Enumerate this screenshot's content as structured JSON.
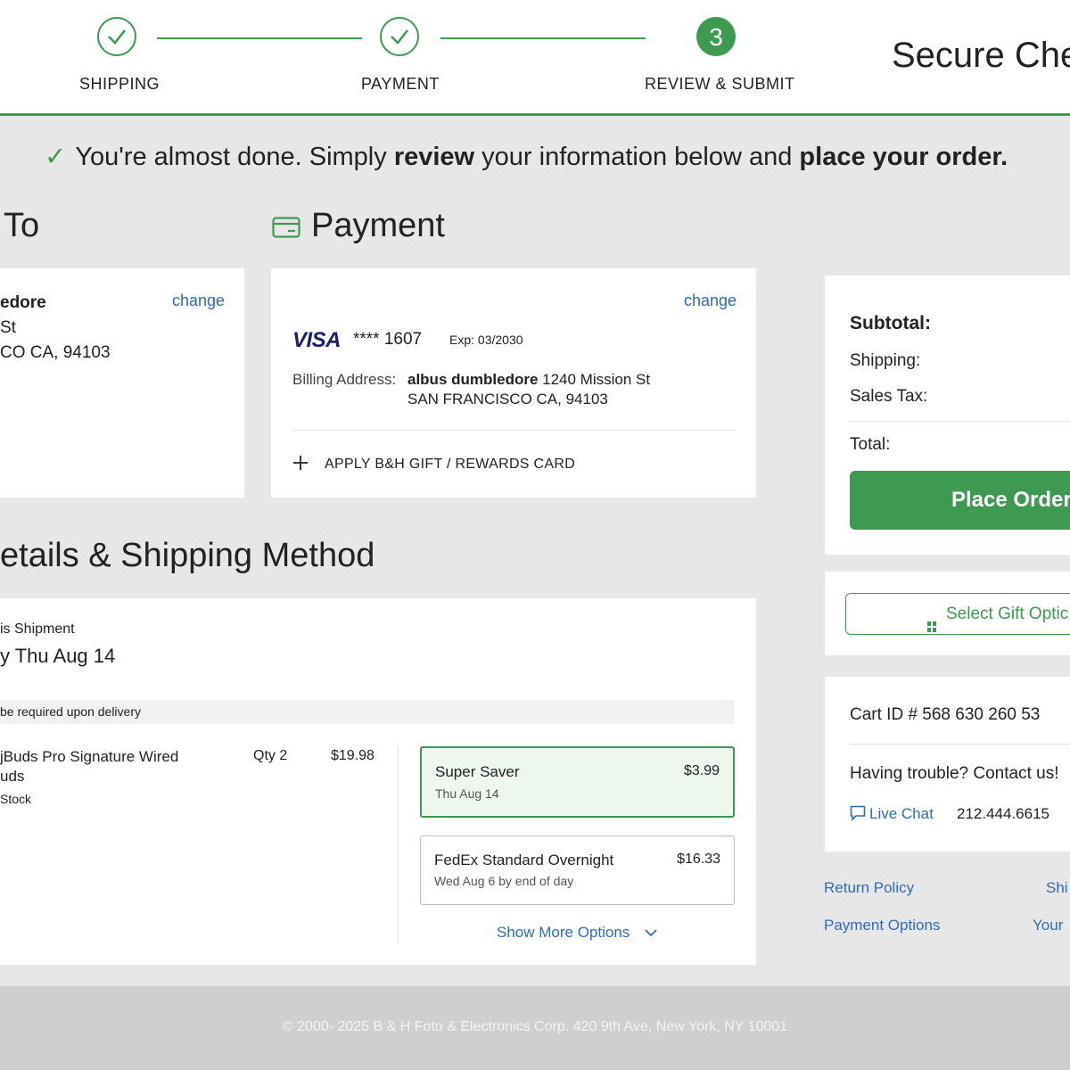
{
  "stepper": {
    "steps": [
      {
        "label": "SHIPPING"
      },
      {
        "label": "PAYMENT"
      },
      {
        "label": "REVIEW & SUBMIT",
        "number": "3"
      }
    ],
    "title": "Secure Che"
  },
  "banner": {
    "part1": "You're almost done. Simply ",
    "bold1": "review",
    "part2": " your information below and ",
    "bold2": "place your order."
  },
  "ship_to": {
    "heading": "To",
    "name": "edore",
    "street": " St",
    "city": "CO CA, 94103",
    "change_label": "change"
  },
  "payment": {
    "heading": "Payment",
    "change_label": "change",
    "card_brand": "VISA",
    "card_masked": "**** 1607",
    "expiry": "Exp: 03/2030",
    "billing_label": "Billing Address:",
    "billing_name": "albus dumbledore",
    "billing_street": " 1240 Mission St",
    "billing_city": "SAN FRANCISCO CA, 94103",
    "gift_card_label": "APPLY B&H GIFT / REWARDS CARD"
  },
  "details": {
    "heading": "etails & Shipping Method",
    "shipment_label": "is Shipment",
    "delivery_date": "y Thu Aug 14",
    "signature_note": "be required upon delivery",
    "item": {
      "name_line1": "jBuds Pro Signature Wired",
      "name_line2": "uds",
      "stock": "Stock",
      "qty": "Qty 2",
      "price": "$19.98"
    },
    "shipping_options": [
      {
        "name": "Super Saver",
        "date": "Thu Aug 14",
        "price": "$3.99",
        "selected": true
      },
      {
        "name": "FedEx Standard Overnight",
        "date": "Wed Aug 6 by end of day",
        "price": "$16.33",
        "selected": false
      }
    ],
    "show_more": "Show More Options"
  },
  "summary": {
    "subtotal_label": "Subtotal:",
    "shipping_label": "Shipping:",
    "tax_label": "Sales Tax:",
    "total_label": "Total:",
    "place_order_label": "Place Order"
  },
  "gift": {
    "label": "Select Gift Optic"
  },
  "support": {
    "cart_id": "Cart ID # 568 630 260 53",
    "trouble": "Having trouble? Contact us!",
    "live_chat": "Live Chat",
    "phone": "212.444.6615"
  },
  "links": {
    "return_policy": "Return Policy",
    "payment_options": "Payment Options",
    "ship": "Shi",
    "your": "Your"
  },
  "footer": {
    "copyright": "© 2000- 2025 B & H Foto & Electronics Corp. 420 9th Ave, New York, NY 10001"
  },
  "colors": {
    "accent": "#3d9a50",
    "link": "#2f6db3",
    "background": "#e7e7e7"
  }
}
